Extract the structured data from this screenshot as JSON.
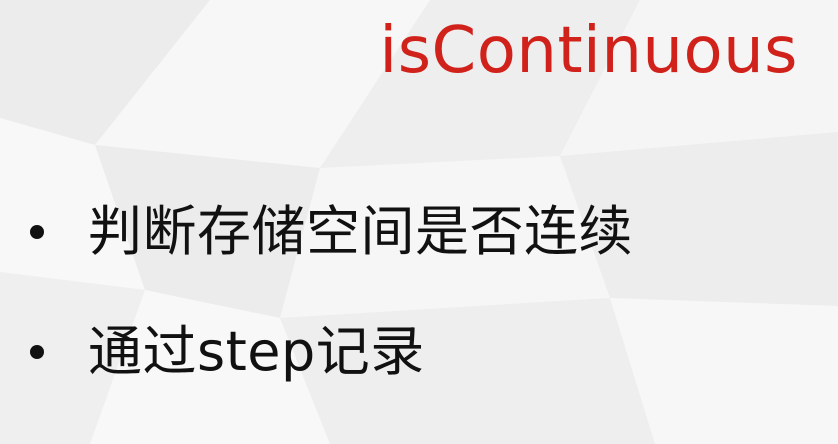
{
  "slide": {
    "title": "isContinuous",
    "bullets": [
      {
        "text": "判断存储空间是否连续"
      },
      {
        "text": "通过step记录"
      }
    ]
  },
  "colors": {
    "title": "#d0211b",
    "text": "#111111",
    "background": "#f2f2f2"
  }
}
